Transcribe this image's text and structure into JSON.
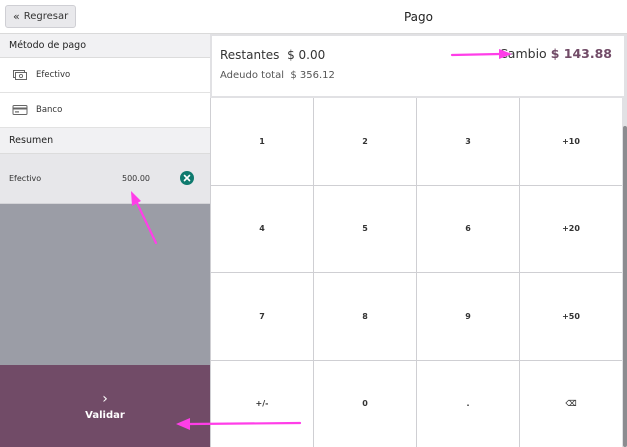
{
  "header": {
    "back_label": "Regresar",
    "title": "Pago"
  },
  "payment_methods": {
    "title": "Método de pago",
    "items": [
      {
        "label": "Efectivo",
        "icon": "cash-icon"
      },
      {
        "label": "Banco",
        "icon": "card-icon"
      }
    ]
  },
  "summary_list": {
    "title": "Resumen",
    "lines": [
      {
        "method": "Efectivo",
        "amount": "500.00",
        "icon": "remove-icon"
      }
    ]
  },
  "validate": {
    "label": "Validar",
    "icon": "chevron-right-icon"
  },
  "totals": {
    "remaining_label": "Restantes",
    "remaining_value": "$ 0.00",
    "due_label": "Adeudo total",
    "due_value": "$ 356.12",
    "change_label": "Cambio",
    "change_value": "$ 143.88"
  },
  "numpad": [
    "1",
    "2",
    "3",
    "+10",
    "4",
    "5",
    "6",
    "+20",
    "7",
    "8",
    "9",
    "+50",
    "+/-",
    "0",
    ".",
    "⌫"
  ],
  "colors": {
    "brand": "#714b67",
    "remove_button": "#0f7a6e",
    "annotation_arrow": "#ff3ee8"
  }
}
